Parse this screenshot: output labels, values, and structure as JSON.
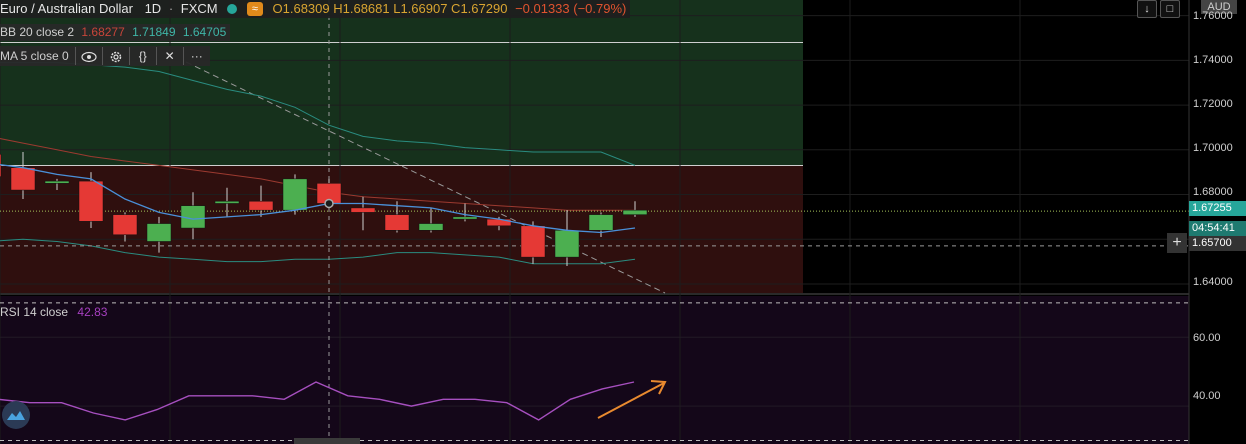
{
  "legend": {
    "title": "Euro / Australian Dollar",
    "interval": "1D",
    "exchange": "FXCM",
    "ohlc_text": "O1.68309 H1.68681 L1.66907 C1.67290",
    "change_text": "−0.01333 (−0.79%)",
    "change_color": "#e0532f"
  },
  "bb_legend": {
    "label": "BB 20 close 2",
    "v1": "1.68277",
    "v2": "1.71849",
    "v3": "1.64705"
  },
  "ma_legend": {
    "label": "MA 5 close 0",
    "icons": [
      "eye-icon",
      "gear-icon",
      "braces-icon",
      "close-icon",
      "more-icon"
    ]
  },
  "rsi_legend": {
    "label": "RSI 14 close",
    "value": "42.83"
  },
  "currency": "AUD",
  "price_axis": {
    "labels": [
      "1.76000",
      "1.74000",
      "1.72000",
      "1.70000",
      "1.68000",
      "1.64000"
    ],
    "current_price": "1.67255",
    "countdown": "04:54:41",
    "crosshair_price": "1.65700"
  },
  "rsi_axis": {
    "labels": [
      "60.00",
      "40.00"
    ]
  },
  "chart_data": {
    "type": "candlestick",
    "ylim": [
      1.6355,
      1.767
    ],
    "candles": [
      {
        "o": 1.698,
        "h": 1.705,
        "l": 1.687,
        "c": 1.688
      },
      {
        "o": 1.692,
        "h": 1.699,
        "l": 1.678,
        "c": 1.682
      },
      {
        "o": 1.685,
        "h": 1.687,
        "l": 1.682,
        "c": 1.686
      },
      {
        "o": 1.686,
        "h": 1.69,
        "l": 1.665,
        "c": 1.668
      },
      {
        "o": 1.671,
        "h": 1.672,
        "l": 1.659,
        "c": 1.662
      },
      {
        "o": 1.659,
        "h": 1.67,
        "l": 1.654,
        "c": 1.667
      },
      {
        "o": 1.665,
        "h": 1.681,
        "l": 1.66,
        "c": 1.675
      },
      {
        "o": 1.676,
        "h": 1.683,
        "l": 1.67,
        "c": 1.677
      },
      {
        "o": 1.677,
        "h": 1.684,
        "l": 1.67,
        "c": 1.673
      },
      {
        "o": 1.673,
        "h": 1.689,
        "l": 1.671,
        "c": 1.687
      },
      {
        "o": 1.685,
        "h": 1.687,
        "l": 1.674,
        "c": 1.676
      },
      {
        "o": 1.674,
        "h": 1.679,
        "l": 1.664,
        "c": 1.672
      },
      {
        "o": 1.671,
        "h": 1.677,
        "l": 1.663,
        "c": 1.664
      },
      {
        "o": 1.664,
        "h": 1.674,
        "l": 1.663,
        "c": 1.667
      },
      {
        "o": 1.669,
        "h": 1.676,
        "l": 1.668,
        "c": 1.67
      },
      {
        "o": 1.669,
        "h": 1.67,
        "l": 1.664,
        "c": 1.666
      },
      {
        "o": 1.666,
        "h": 1.668,
        "l": 1.649,
        "c": 1.652
      },
      {
        "o": 1.652,
        "h": 1.673,
        "l": 1.648,
        "c": 1.664
      },
      {
        "o": 1.664,
        "h": 1.672,
        "l": 1.661,
        "c": 1.671
      },
      {
        "o": 1.671,
        "h": 1.677,
        "l": 1.67,
        "c": 1.673
      }
    ],
    "ma": [
      1.694,
      1.692,
      1.689,
      1.687,
      1.678,
      1.672,
      1.669,
      1.67,
      1.671,
      1.673,
      1.676,
      1.676,
      1.675,
      1.674,
      1.671,
      1.669,
      1.666,
      1.664,
      1.663,
      1.665
    ],
    "bb_upper": [
      1.739,
      1.739,
      1.739,
      1.738,
      1.737,
      1.735,
      1.731,
      1.727,
      1.724,
      1.719,
      1.711,
      1.706,
      1.704,
      1.703,
      1.701,
      1.7,
      1.699,
      1.699,
      1.699,
      1.693
    ],
    "bb_middle": [
      1.706,
      1.703,
      1.7,
      1.697,
      1.695,
      1.693,
      1.691,
      1.689,
      1.687,
      1.684,
      1.681,
      1.679,
      1.678,
      1.677,
      1.676,
      1.675,
      1.674,
      1.673,
      1.673,
      1.673
    ],
    "bb_lower": [
      1.659,
      1.66,
      1.659,
      1.657,
      1.654,
      1.652,
      1.651,
      1.65,
      1.65,
      1.651,
      1.651,
      1.652,
      1.654,
      1.654,
      1.653,
      1.652,
      1.649,
      1.649,
      1.649,
      1.651
    ],
    "rsi": [
      42,
      41,
      41,
      38,
      36,
      39,
      43,
      43,
      43,
      42,
      47,
      43,
      42,
      40,
      42,
      42,
      41,
      36,
      42,
      45,
      47
    ],
    "rsi_ylim": [
      29,
      72
    ],
    "rsi_levels": [
      70,
      30
    ],
    "colors": {
      "bull": "#4caf50",
      "bear": "#e53935",
      "ma": "#4a90d9",
      "bb_bands": "#2a8c80",
      "bb_middle": "#9c3a30",
      "rsi": "#a64fbf",
      "arrow": "#e98a2f",
      "long_zone": "#16311c",
      "short_zone": "#2f0f0e",
      "rsi_bg": "#140719"
    }
  }
}
